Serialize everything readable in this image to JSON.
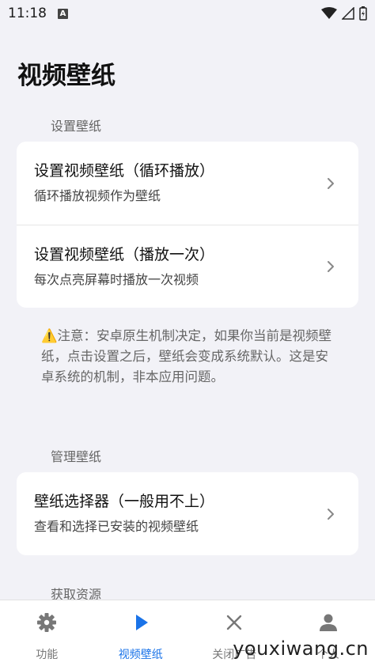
{
  "status_bar": {
    "time": "11:18",
    "notif_letter": "A"
  },
  "page": {
    "title": "视频壁纸"
  },
  "sections": {
    "set": "设置壁纸",
    "manage": "管理壁纸",
    "resources": "获取资源"
  },
  "set_card": [
    {
      "title": "设置视频壁纸（循环播放）",
      "subtitle": "循环播放视频作为壁纸"
    },
    {
      "title": "设置视频壁纸（播放一次）",
      "subtitle": "每次点亮屏幕时播放一次视频"
    }
  ],
  "note": "⚠️注意：安卓原生机制决定，如果你当前是视频壁纸，点击设置之后，壁纸会变成系统默认。这是安卓系统的机制，非本应用问题。",
  "manage_card": [
    {
      "title": "壁纸选择器（一般用不上）",
      "subtitle": "查看和选择已安装的视频壁纸"
    }
  ],
  "bottom_nav": [
    {
      "label": "功能",
      "icon": "gear-icon",
      "active": false
    },
    {
      "label": "视频壁纸",
      "icon": "play-icon",
      "active": true
    },
    {
      "label": "关闭广告",
      "icon": "close-icon",
      "active": false
    },
    {
      "label": "个人",
      "icon": "person-icon",
      "active": false
    }
  ],
  "watermark": "youxiwang.cn",
  "colors": {
    "accent": "#1a73e8",
    "background": "#f2f2f7"
  }
}
